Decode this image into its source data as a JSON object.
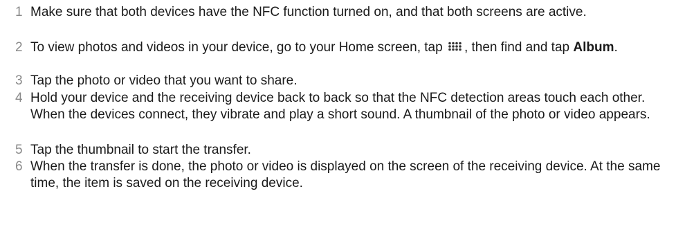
{
  "steps": [
    {
      "number": "1",
      "text": "Make sure that both devices have the NFC function turned on, and that both screens are active."
    },
    {
      "number": "2",
      "text_before_icon": "To view photos and videos in your device, go to your Home screen, tap ",
      "icon": "apps-grid-icon",
      "text_after_icon": ", then find and tap ",
      "bold": "Album",
      "text_end": "."
    },
    {
      "number": "3",
      "text": "Tap the photo or video that you want to share."
    },
    {
      "number": "4",
      "text": "Hold your device and the receiving device back to back so that the NFC detection areas touch each other. When the devices connect, they vibrate and play a short sound. A thumbnail of the photo or video appears."
    },
    {
      "number": "5",
      "text": "Tap the thumbnail to start the transfer."
    },
    {
      "number": "6",
      "text": "When the transfer is done, the photo or video is displayed on the screen of the receiving device. At the same time, the item is saved on the receiving device."
    }
  ]
}
